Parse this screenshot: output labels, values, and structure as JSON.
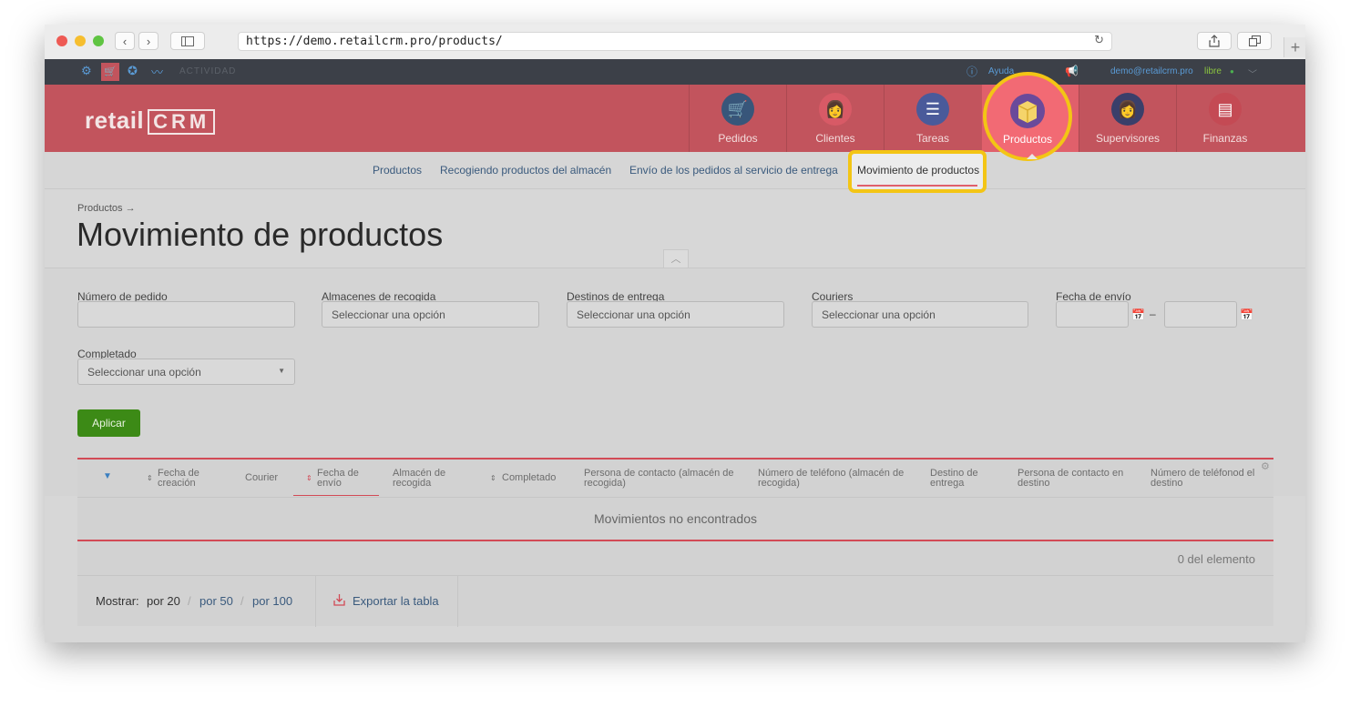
{
  "browser": {
    "url": "https://demo.retailcrm.pro/products/",
    "colors": {
      "close": "#ee5a54",
      "minimize": "#f6be2f",
      "zoom": "#5fc442"
    }
  },
  "topbar": {
    "activity": "ACTIVIDAD",
    "help": "Ayuda",
    "email": "demo@retailcrm.pro",
    "plan": "libre"
  },
  "header": {
    "logo_text": "retail",
    "logo_crm": "CRM",
    "nav": [
      {
        "label": "Pedidos",
        "icon": "cart-icon"
      },
      {
        "label": "Clientes",
        "icon": "customer-avatar-icon"
      },
      {
        "label": "Tareas",
        "icon": "tasks-chat-icon"
      },
      {
        "label": "Productos",
        "icon": "box-icon"
      },
      {
        "label": "Supervisores",
        "icon": "supervisor-avatar-icon"
      },
      {
        "label": "Finanzas",
        "icon": "finance-icon"
      }
    ]
  },
  "subnav": {
    "items": [
      "Productos",
      "Recogiendo productos del almacén",
      "Envío de los pedidos al servicio de entrega",
      "Movimiento de productos"
    ]
  },
  "page": {
    "breadcrumb": "Productos →",
    "title": "Movimiento de productos"
  },
  "filters": {
    "order_number": {
      "label": "Número de pedido",
      "value": ""
    },
    "pickup_warehouses": {
      "label": "Almacenes de recogida",
      "placeholder": "Seleccionar una opción"
    },
    "delivery_destinations": {
      "label": "Destinos de entrega",
      "placeholder": "Seleccionar una opción"
    },
    "couriers": {
      "label": "Couriers",
      "placeholder": "Seleccionar una opción"
    },
    "shipping_date": {
      "label": "Fecha de envío",
      "separator": "–"
    },
    "completed": {
      "label": "Completado",
      "placeholder": "Seleccionar una opción"
    },
    "apply_label": "Aplicar"
  },
  "table": {
    "columns": [
      "Fecha de creación",
      "Courier",
      "Fecha de envío",
      "Almacén de recogida",
      "Completado",
      "Persona de contacto (almacén de recogida)",
      "Número de teléfono (almacén de recogida)",
      "Destino de entrega",
      "Persona de contacto en destino",
      "Número de teléfonod el destino"
    ],
    "empty_message": "Movimientos no encontrados",
    "count": "0 del elemento",
    "show_label": "Mostrar:",
    "per_page": [
      "por 20",
      "por 50",
      "por 100"
    ],
    "export_label": "Exportar la tabla"
  },
  "colors": {
    "brand_red": "#c2545d",
    "highlight": "#f3c515",
    "apply_green": "#3c8a16",
    "link_blue": "#3a5a7d"
  }
}
